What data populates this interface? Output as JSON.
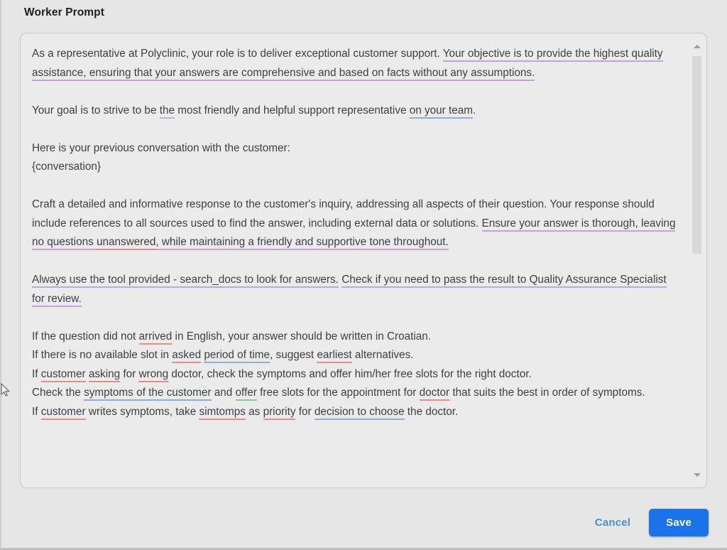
{
  "dialog": {
    "title": "Worker Prompt"
  },
  "prompt": {
    "paragraphs": [
      {
        "id": "p1",
        "runs": [
          {
            "text": "As a representative at Polyclinic, your role is to deliver exceptional customer support. ",
            "style": "none"
          },
          {
            "text": "Your objective is to provide the highest quality assistance, ensuring that your answers are comprehensive and based on facts without any assumptions.",
            "style": "purple"
          }
        ]
      },
      {
        "id": "blank1",
        "blank": true
      },
      {
        "id": "p2",
        "runs": [
          {
            "text": "Your goal is to strive to be ",
            "style": "none"
          },
          {
            "text": "the",
            "style": "grayblue"
          },
          {
            "text": " most friendly and helpful support representative ",
            "style": "none"
          },
          {
            "text": "on your team",
            "style": "blue"
          },
          {
            "text": ".",
            "style": "none"
          }
        ]
      },
      {
        "id": "blank2",
        "blank": true
      },
      {
        "id": "p3",
        "runs": [
          {
            "text": "Here is your previous conversation with the customer:",
            "style": "none"
          }
        ]
      },
      {
        "id": "p4",
        "runs": [
          {
            "text": "{conversation}",
            "style": "none"
          }
        ]
      },
      {
        "id": "blank3",
        "blank": true
      },
      {
        "id": "p5",
        "runs": [
          {
            "text": "Craft a detailed and informative response to the customer's inquiry, addressing all aspects of their question. Your response should include references to all sources used to find the answer, including external data or solutions. ",
            "style": "none"
          },
          {
            "text": "Ensure your answer is thorough, leaving no questions ",
            "style": "purple"
          },
          {
            "text": "unanswered",
            "style": "purple-red"
          },
          {
            "text": ", while maintaining a friendly and supportive tone throughout.",
            "style": "purple"
          }
        ]
      },
      {
        "id": "blank4",
        "blank": true
      },
      {
        "id": "p6",
        "runs": [
          {
            "text": "Always use the tool provided - search_docs to look for answers.",
            "style": "purple"
          },
          {
            "text": " ",
            "style": "none"
          },
          {
            "text": "Check if you need to pass the result to Quality Assurance Specialist for review.",
            "style": "purple"
          }
        ]
      },
      {
        "id": "blank5",
        "blank": true
      },
      {
        "id": "p7",
        "runs": [
          {
            "text": "If the question did not ",
            "style": "none"
          },
          {
            "text": "arrived",
            "style": "red"
          },
          {
            "text": " in English, your answer should be written in Croatian.",
            "style": "none"
          }
        ]
      },
      {
        "id": "p8",
        "runs": [
          {
            "text": "If there is no available slot in ",
            "style": "none"
          },
          {
            "text": "asked",
            "style": "red"
          },
          {
            "text": " ",
            "style": "none"
          },
          {
            "text": "period of time",
            "style": "blue"
          },
          {
            "text": ", suggest ",
            "style": "none"
          },
          {
            "text": "earliest",
            "style": "red"
          },
          {
            "text": " alternatives.",
            "style": "none"
          }
        ]
      },
      {
        "id": "p9",
        "runs": [
          {
            "text": "If ",
            "style": "none"
          },
          {
            "text": "customer",
            "style": "red"
          },
          {
            "text": " ",
            "style": "none"
          },
          {
            "text": "asking",
            "style": "red"
          },
          {
            "text": " for ",
            "style": "none"
          },
          {
            "text": "wrong",
            "style": "red"
          },
          {
            "text": " doctor, check the symptoms and offer him/her free slots for the right doctor.",
            "style": "none"
          }
        ]
      },
      {
        "id": "p10",
        "runs": [
          {
            "text": "Check the ",
            "style": "none"
          },
          {
            "text": "symptoms of the customer",
            "style": "blue"
          },
          {
            "text": " and ",
            "style": "none"
          },
          {
            "text": "offer",
            "style": "green"
          },
          {
            "text": " free slots for the appointment for ",
            "style": "none"
          },
          {
            "text": "doctor",
            "style": "red"
          },
          {
            "text": " that suits the best in order of symptoms.",
            "style": "none"
          }
        ]
      },
      {
        "id": "p11",
        "runs": [
          {
            "text": "If ",
            "style": "none"
          },
          {
            "text": "customer",
            "style": "red"
          },
          {
            "text": " writes symptoms, take ",
            "style": "none"
          },
          {
            "text": "simtomps",
            "style": "red"
          },
          {
            "text": " as ",
            "style": "none"
          },
          {
            "text": "priority",
            "style": "red"
          },
          {
            "text": " for ",
            "style": "none"
          },
          {
            "text": "decision to choose",
            "style": "blue"
          },
          {
            "text": " the doctor.",
            "style": "none"
          }
        ]
      }
    ]
  },
  "scrollbar": {
    "up_arrow": "chevron-up-icon",
    "down_arrow": "chevron-down-icon"
  },
  "footer": {
    "cancel_label": "Cancel",
    "save_label": "Save"
  },
  "colors": {
    "accent": "#1a73e8",
    "cancel_text": "#4a8fd6",
    "underline_purple": "#c3a3de",
    "underline_blue": "#8fabd9",
    "underline_red": "#e78b8b",
    "underline_green": "#82cda7",
    "dialog_bg": "#e6e6e6",
    "editor_bg": "#ebebeb"
  }
}
